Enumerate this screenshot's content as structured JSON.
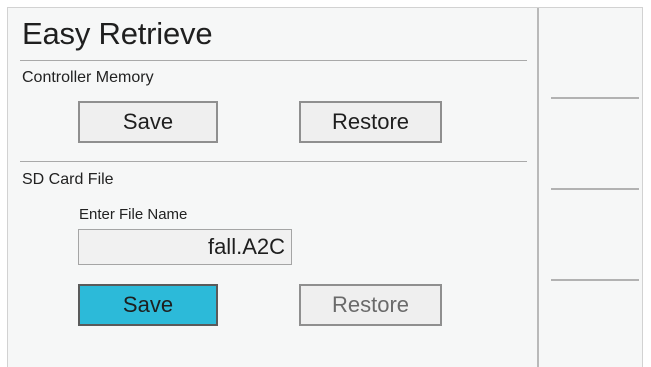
{
  "app": {
    "title": "Easy Retrieve"
  },
  "controller_memory": {
    "label": "Controller Memory",
    "save_label": "Save",
    "restore_label": "Restore"
  },
  "sd_card": {
    "label": "SD Card File",
    "file_name_label": "Enter File Name",
    "file_name_value": "fall.A2C",
    "save_label": "Save",
    "restore_label": "Restore"
  },
  "colors": {
    "selected_button": "#2cbad9",
    "screen_background": "#f6f7f7"
  }
}
